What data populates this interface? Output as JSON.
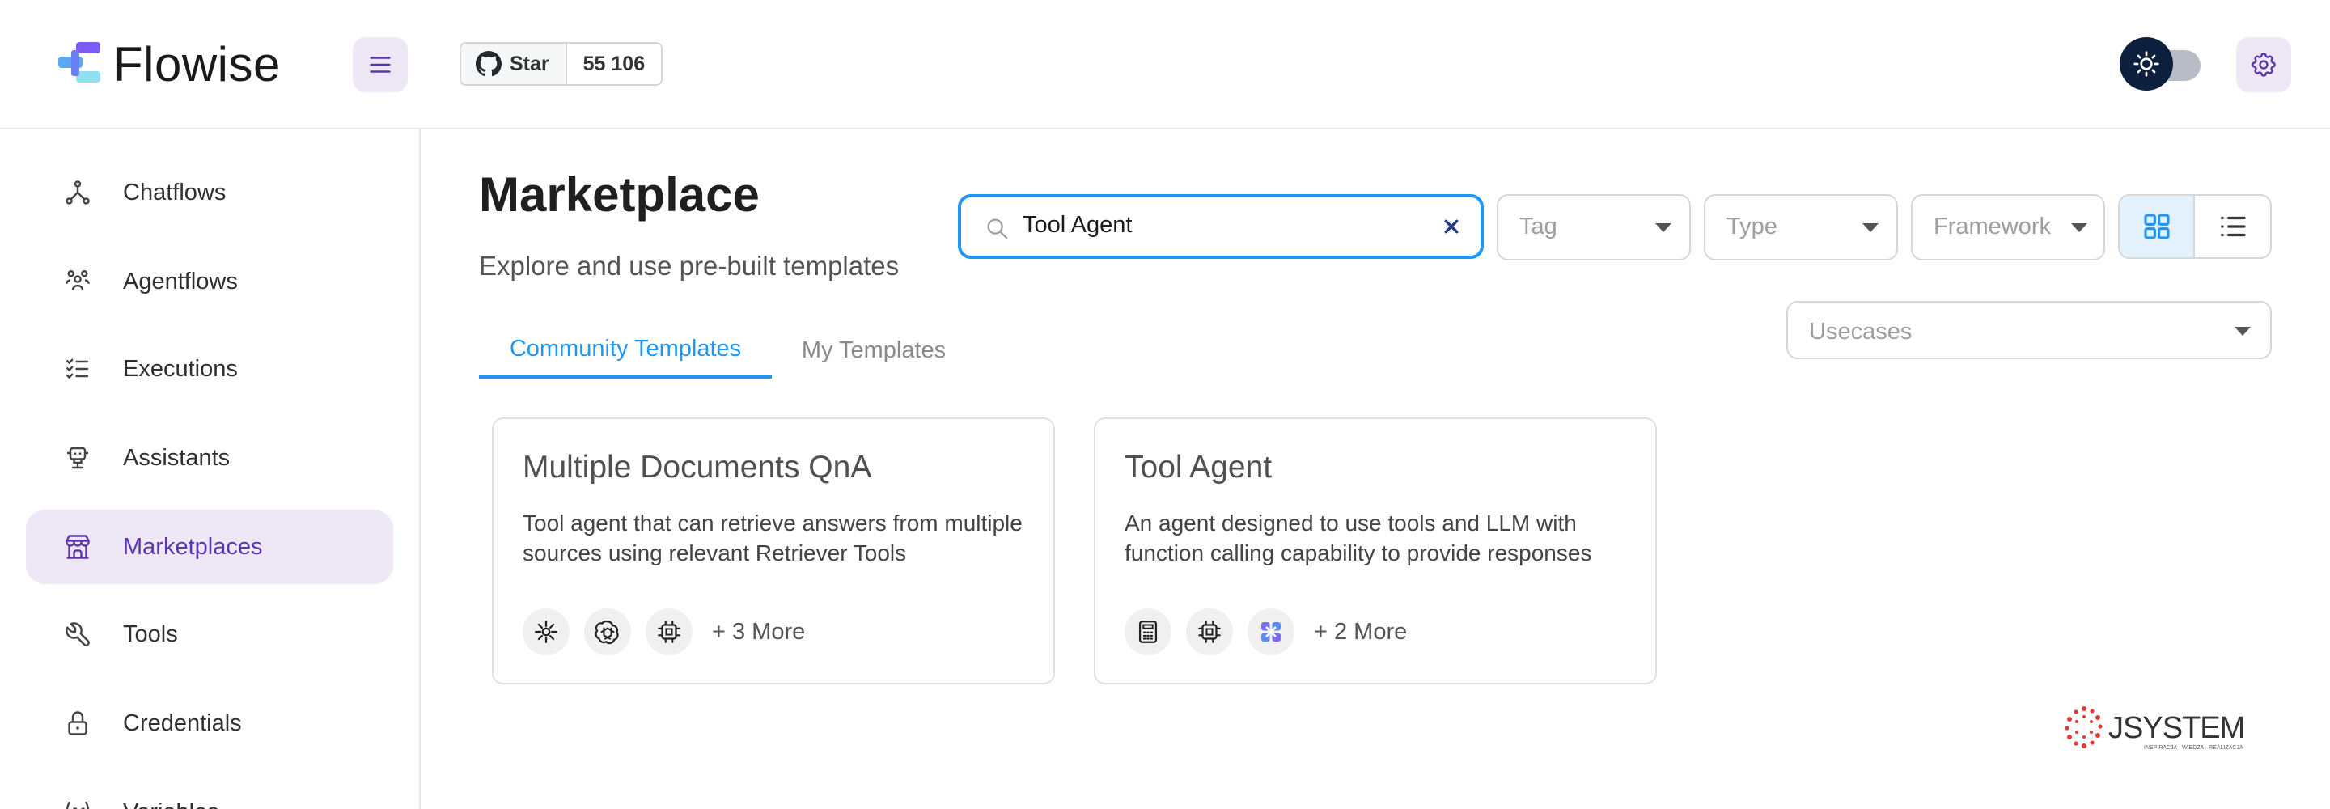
{
  "app": {
    "name": "Flowise"
  },
  "header": {
    "github": {
      "star_label": "Star",
      "star_count": "55 106"
    }
  },
  "sidebar": {
    "items": [
      {
        "label": "Chatflows",
        "icon": "hierarchy-icon",
        "active": false
      },
      {
        "label": "Agentflows",
        "icon": "users-group-icon",
        "active": false
      },
      {
        "label": "Executions",
        "icon": "list-check-icon",
        "active": false
      },
      {
        "label": "Assistants",
        "icon": "robot-icon",
        "active": false
      },
      {
        "label": "Marketplaces",
        "icon": "building-store-icon",
        "active": true
      },
      {
        "label": "Tools",
        "icon": "tool-icon",
        "active": false
      },
      {
        "label": "Credentials",
        "icon": "lock-icon",
        "active": false
      },
      {
        "label": "Variables",
        "icon": "variable-icon",
        "active": false
      }
    ]
  },
  "main": {
    "title": "Marketplace",
    "subtitle": "Explore and use pre-built templates",
    "search": {
      "value": "Tool Agent"
    },
    "filters": {
      "tag_placeholder": "Tag",
      "type_placeholder": "Type",
      "framework_placeholder": "Framework",
      "usecases_placeholder": "Usecases"
    },
    "view_mode": "grid",
    "tabs": [
      {
        "label": "Community Templates",
        "active": true
      },
      {
        "label": "My Templates",
        "active": false
      }
    ],
    "cards": [
      {
        "title": "Multiple Documents QnA",
        "description": "Tool agent that can retrieve answers from multiple sources using relevant Retriever Tools",
        "node_icons": [
          "retriever-icon",
          "openai-icon",
          "chip-icon"
        ],
        "more": "+ 3 More"
      },
      {
        "title": "Tool Agent",
        "description": "An agent designed to use tools and LLM with function calling capability to provide responses",
        "node_icons": [
          "calculator-icon",
          "chip-icon",
          "tool-node-icon"
        ],
        "more": "+ 2 More"
      }
    ]
  },
  "colors": {
    "accent_purple": "#5e35b1",
    "accent_purple_bg": "#ede7f6",
    "accent_blue": "#2196f3"
  },
  "watermark": {
    "brand": "JSYSTEMS",
    "tagline": "INSPIRACJA · WIEDZA · REALIZACJA"
  }
}
